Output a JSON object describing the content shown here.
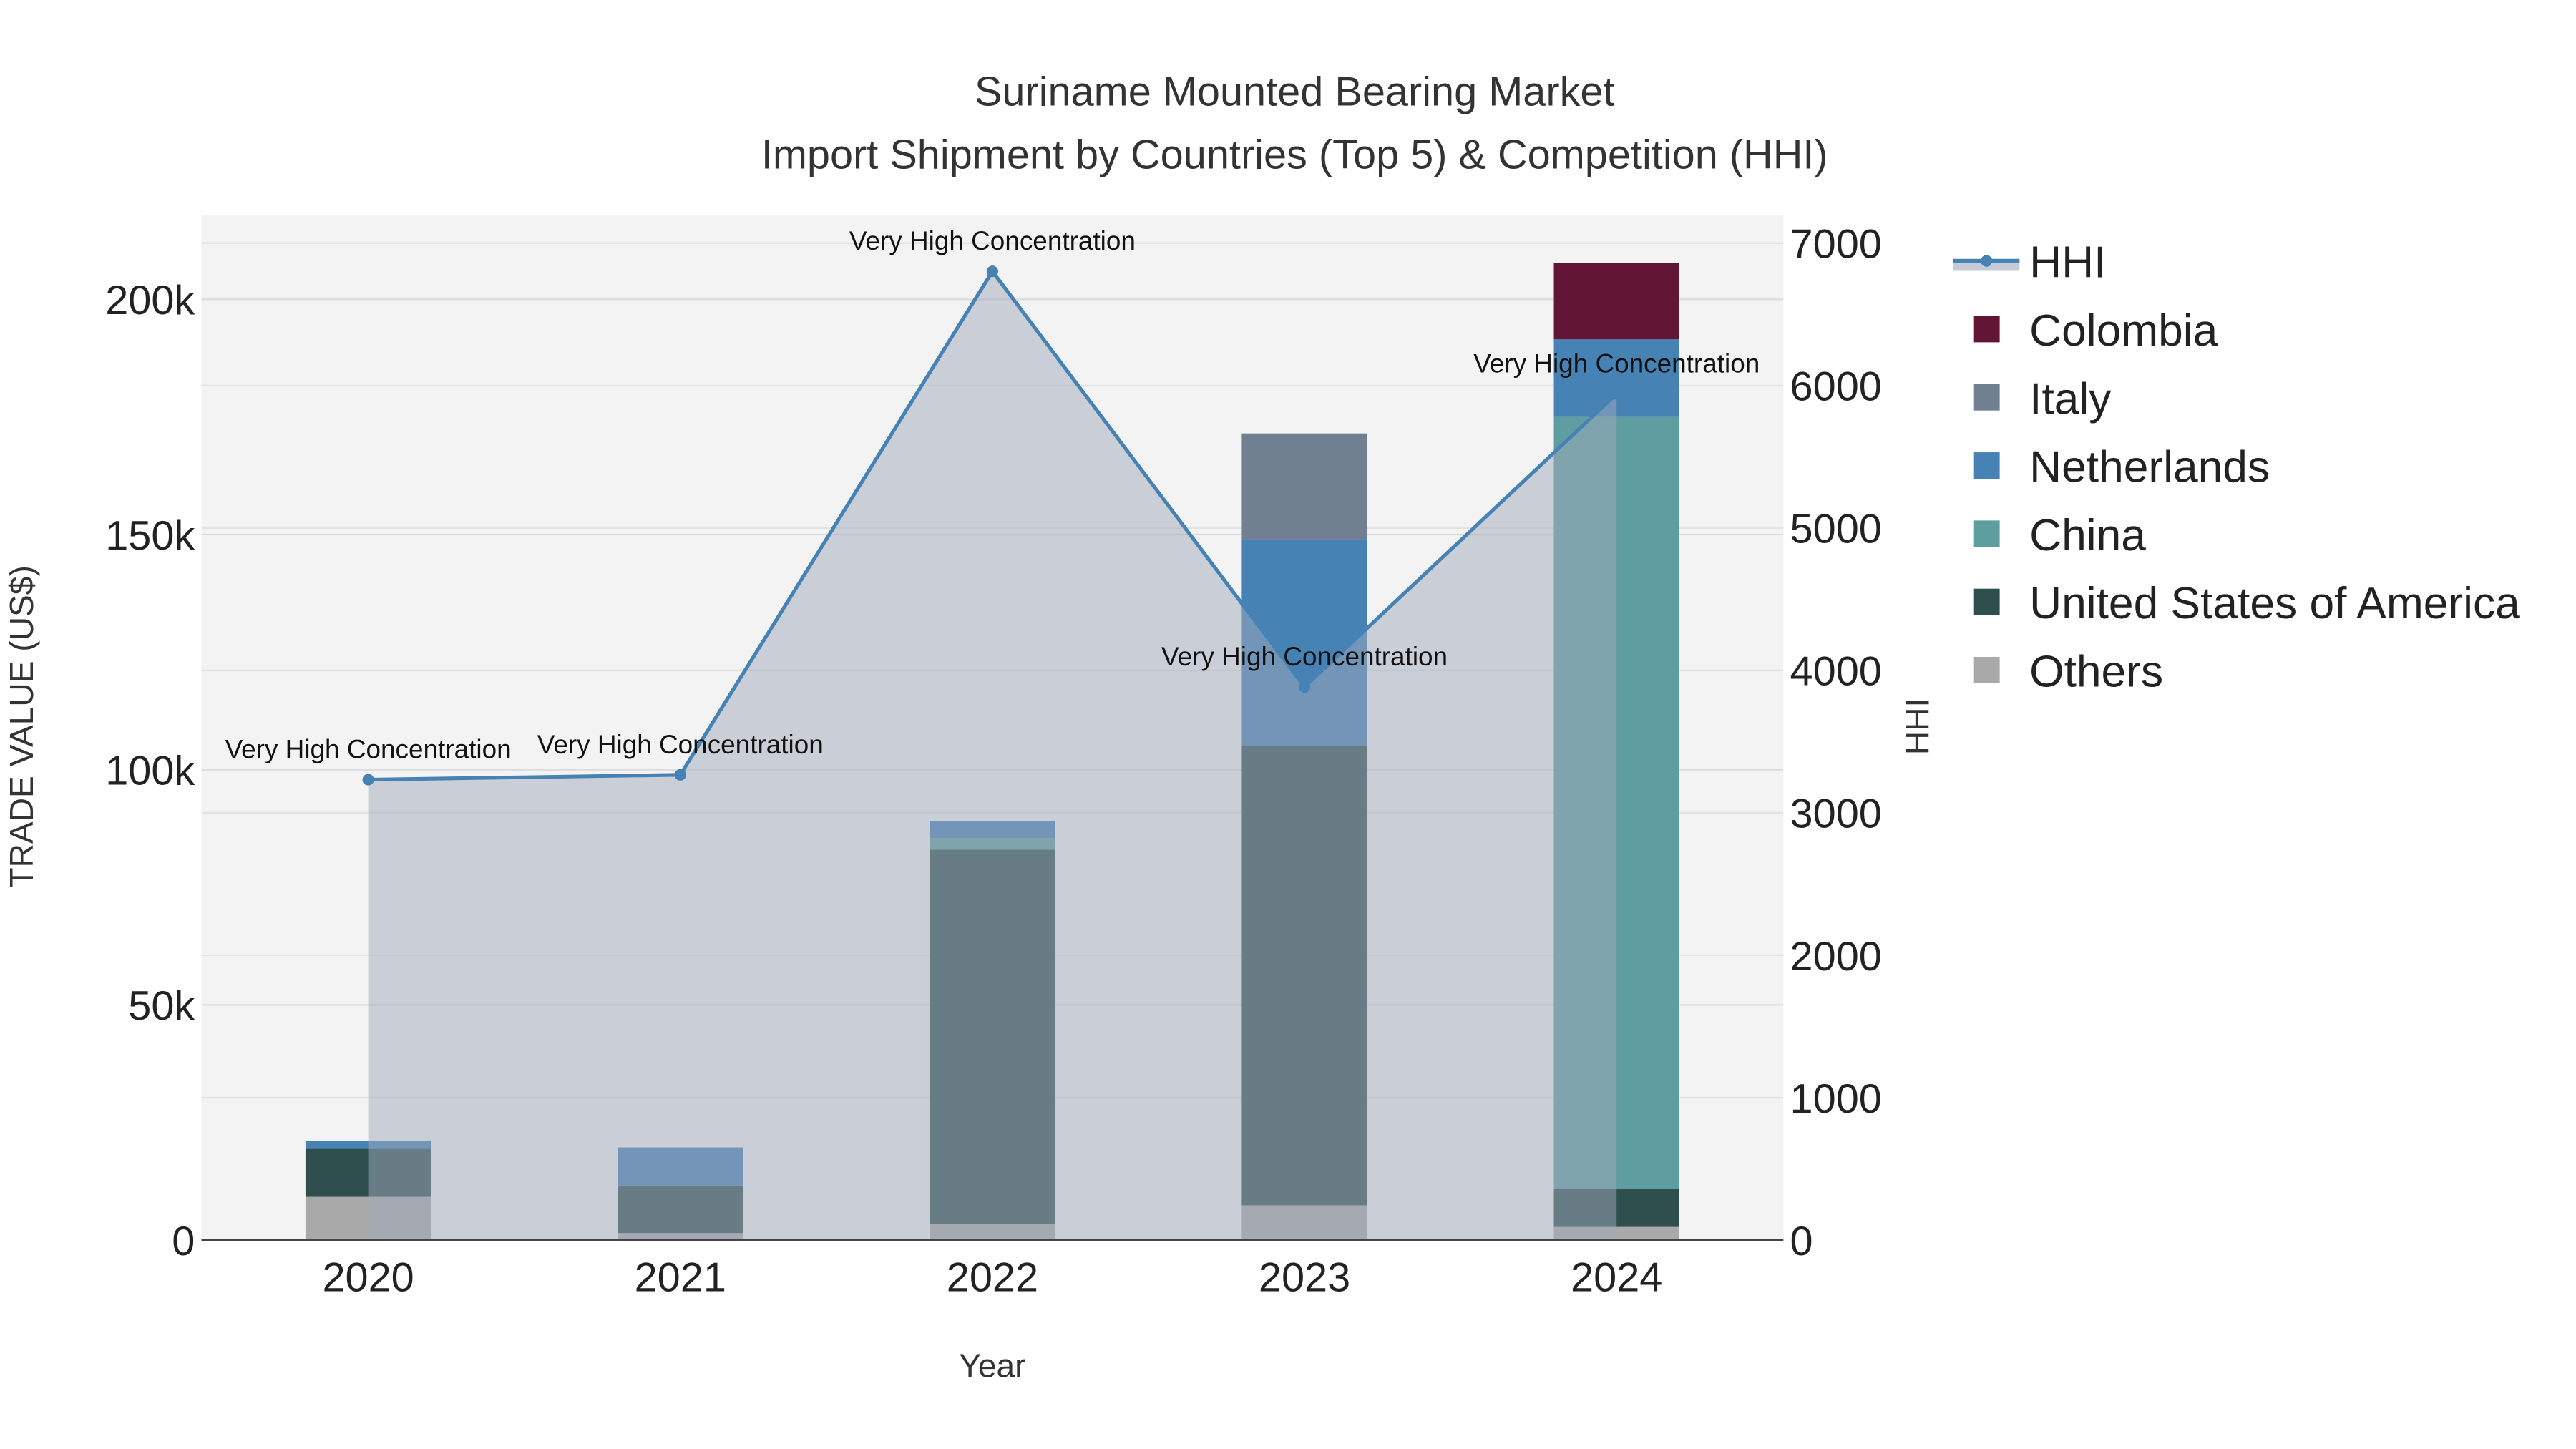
{
  "chart_data": {
    "type": "bar",
    "title": "Suriname Mounted Bearing Market",
    "subtitle": "Import Shipment by Countries (Top 5) & Competition (HHI)",
    "xlabel": "Year",
    "ylabel": "TRADE VALUE (US$)",
    "y2label": "HHI",
    "categories": [
      "2020",
      "2021",
      "2022",
      "2023",
      "2024"
    ],
    "ylim": [
      0,
      218000
    ],
    "y2lim": [
      0,
      7200
    ],
    "yticks": [
      0,
      50000,
      100000,
      150000,
      200000
    ],
    "ytick_labels": [
      "0",
      "50k",
      "100k",
      "150k",
      "200k"
    ],
    "y2ticks": [
      0,
      1000,
      2000,
      3000,
      4000,
      5000,
      6000,
      7000
    ],
    "y2tick_labels": [
      "0",
      "1000",
      "2000",
      "3000",
      "4000",
      "5000",
      "6000",
      "7000"
    ],
    "stacked": true,
    "series": [
      {
        "name": "Others",
        "color": "#A9A9A9",
        "values": [
          9200,
          1500,
          3500,
          7400,
          2800
        ]
      },
      {
        "name": "United States of America",
        "color": "#2F4F4F",
        "values": [
          10200,
          10100,
          79500,
          97600,
          8100
        ]
      },
      {
        "name": "China",
        "color": "#5F9EA0",
        "values": [
          0,
          0,
          2500,
          0,
          164100
        ]
      },
      {
        "name": "Netherlands",
        "color": "#4682B4",
        "values": [
          1700,
          8100,
          3500,
          44000,
          16500
        ]
      },
      {
        "name": "Italy",
        "color": "#708090",
        "values": [
          0,
          0,
          0,
          22500,
          0
        ]
      },
      {
        "name": "Colombia",
        "color": "#631535",
        "values": [
          0,
          0,
          0,
          0,
          16200
        ]
      }
    ],
    "line": {
      "name": "HHI",
      "color": "#4682B4",
      "values": [
        3233,
        3267,
        6802,
        3884,
        5942
      ],
      "annotations": [
        "Very High Concentration",
        "Very High Concentration",
        "Very High Concentration",
        "Very High Concentration",
        "Very High Concentration"
      ]
    },
    "legend": {
      "placement": "right",
      "items": [
        "HHI",
        "Colombia",
        "Italy",
        "Netherlands",
        "China",
        "United States of America",
        "Others"
      ]
    },
    "grid": true
  }
}
